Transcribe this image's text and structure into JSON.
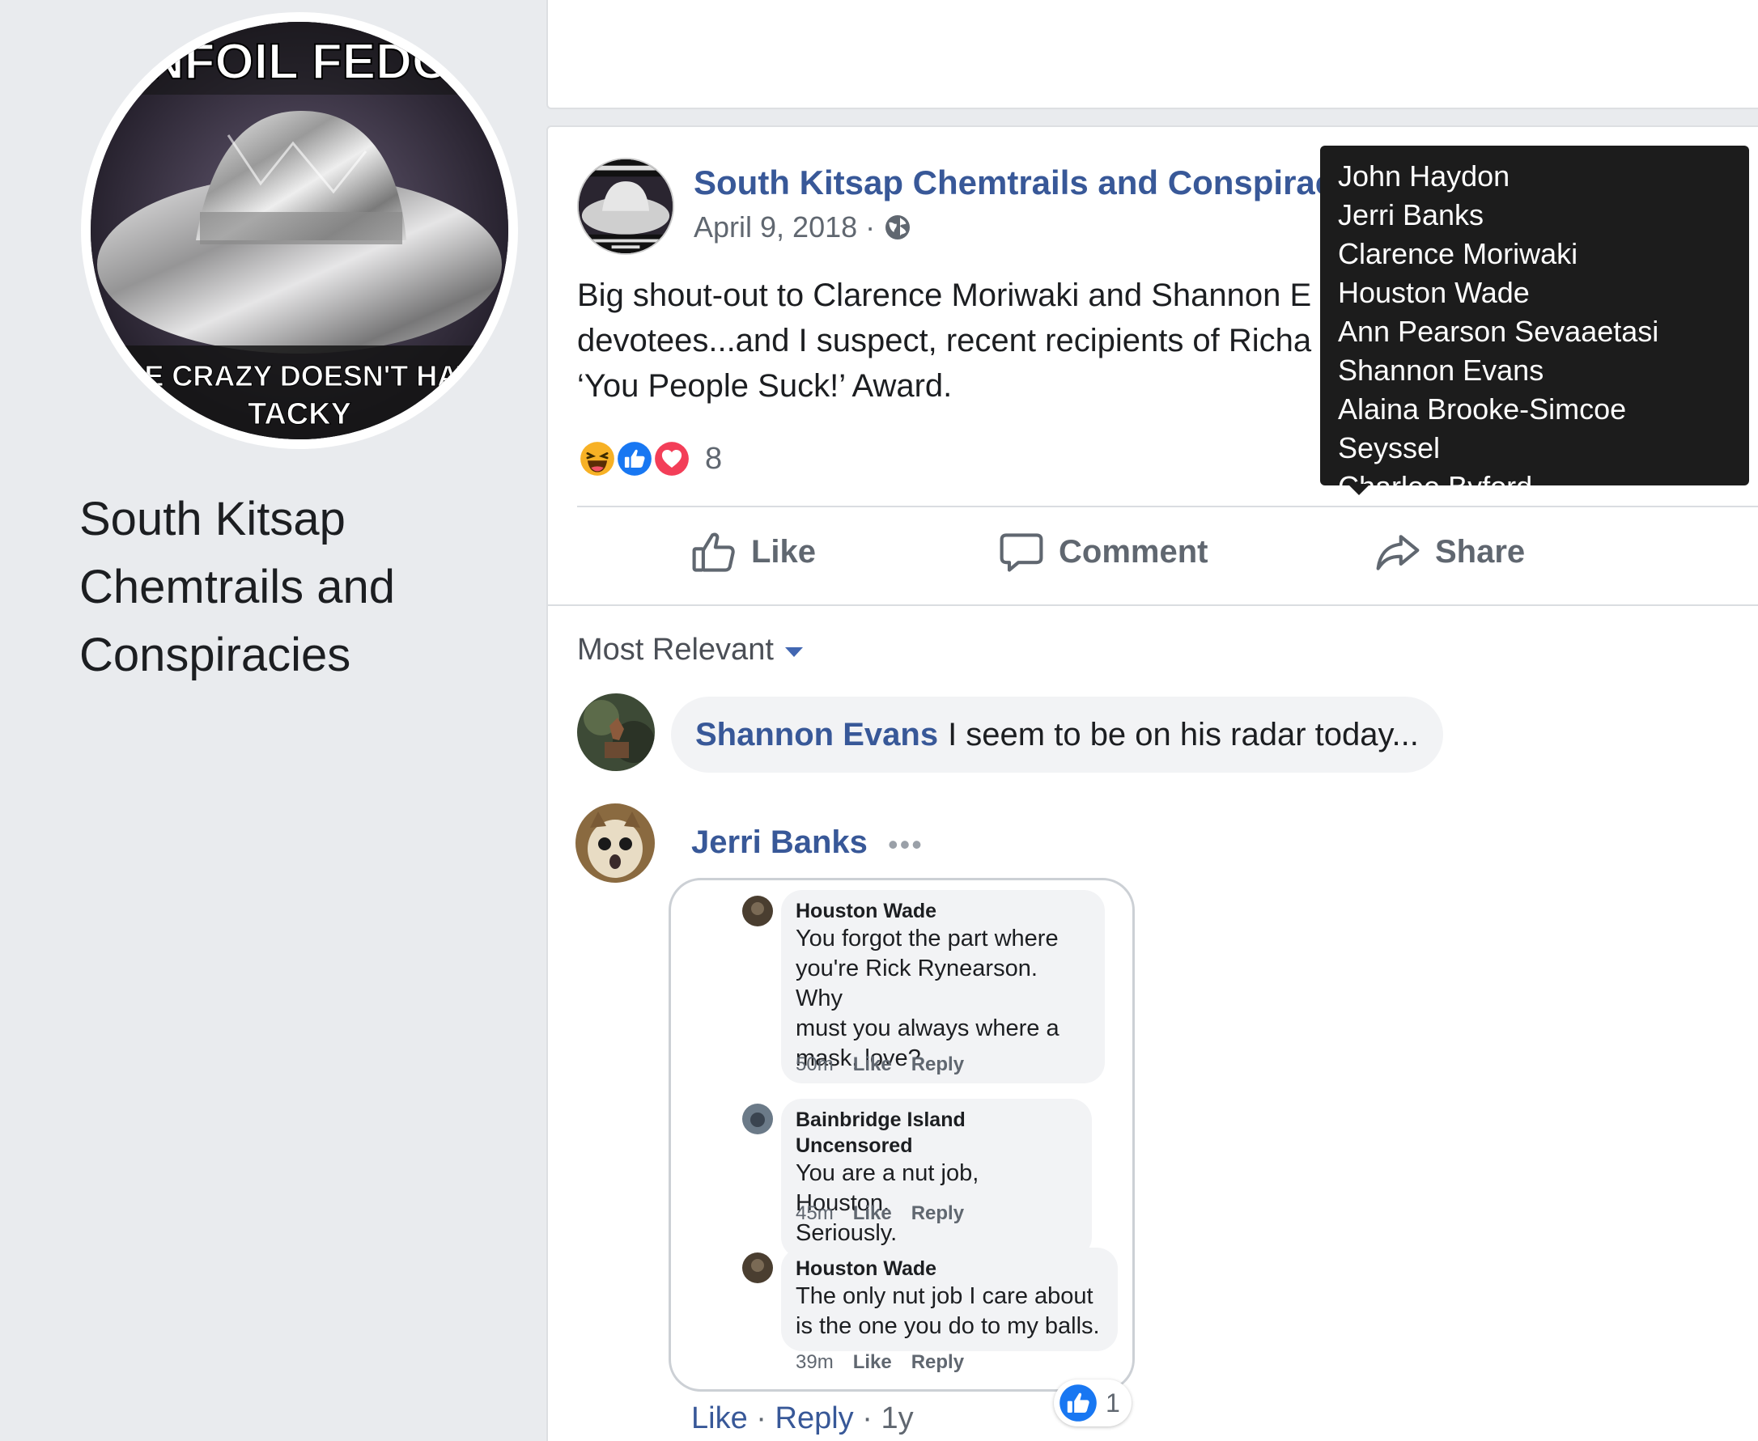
{
  "page": {
    "name": "South Kitsap Chemtrails and Conspiracies",
    "name_lines": [
      "South Kitsap",
      "Chemtrails and",
      "Conspiracies"
    ],
    "profile_pic_text_top": "NFOIL FEDO",
    "profile_pic_text_bottom_1": "USE CRAZY DOESN'T HAVE",
    "profile_pic_text_bottom_2": "TACKY"
  },
  "post": {
    "author": "South Kitsap Chemtrails and Conspiracie",
    "date": "April 9, 2018 ·",
    "text_lines": [
      "Big shout-out to Clarence Moriwaki and Shannon E",
      "devotees...and I suspect, recent recipients of Richa",
      "‘You People Suck!’ Award."
    ],
    "reaction_count": "8",
    "actions": {
      "like": "Like",
      "comment": "Comment",
      "share": "Share"
    }
  },
  "reactions_tooltip": {
    "names": [
      "John Haydon",
      "Jerri Banks",
      "Clarence Moriwaki",
      "Houston Wade",
      "Ann Pearson Sevaaetasi",
      "Shannon Evans",
      "Alaina Brooke-Simcoe Seyssel",
      "Charlee Byford"
    ]
  },
  "comments": {
    "sort_label": "Most Relevant",
    "first": {
      "author": "Shannon Evans",
      "text": "I seem to be on his radar today..."
    },
    "second": {
      "author": "Jerri Banks",
      "more": "•••",
      "like_count": "1",
      "links": {
        "like": "Like",
        "sep1": " · ",
        "reply": "Reply",
        "sep2": " · ",
        "age": "1y"
      },
      "screenshot": [
        {
          "author": "Houston Wade",
          "lines": [
            "You forgot the part where",
            "you're Rick Rynearson. Why",
            "must you always where a",
            "mask, love?"
          ],
          "time": "50m",
          "like": "Like",
          "reply": "Reply"
        },
        {
          "author": "Bainbridge Island Uncensored",
          "lines": [
            "You are a nut job, Houston.",
            "Seriously."
          ],
          "time": "45m",
          "like": "Like",
          "reply": "Reply"
        },
        {
          "author": "Houston Wade",
          "lines": [
            "The only nut job I care about",
            "is the one you do to my balls."
          ],
          "time": "39m",
          "like": "Like",
          "reply": "Reply"
        }
      ]
    }
  },
  "colors": {
    "link_blue": "#385898",
    "fb_blue": "#4267b2",
    "background": "#e9ebee",
    "tooltip_bg": "#1c1c1c"
  }
}
